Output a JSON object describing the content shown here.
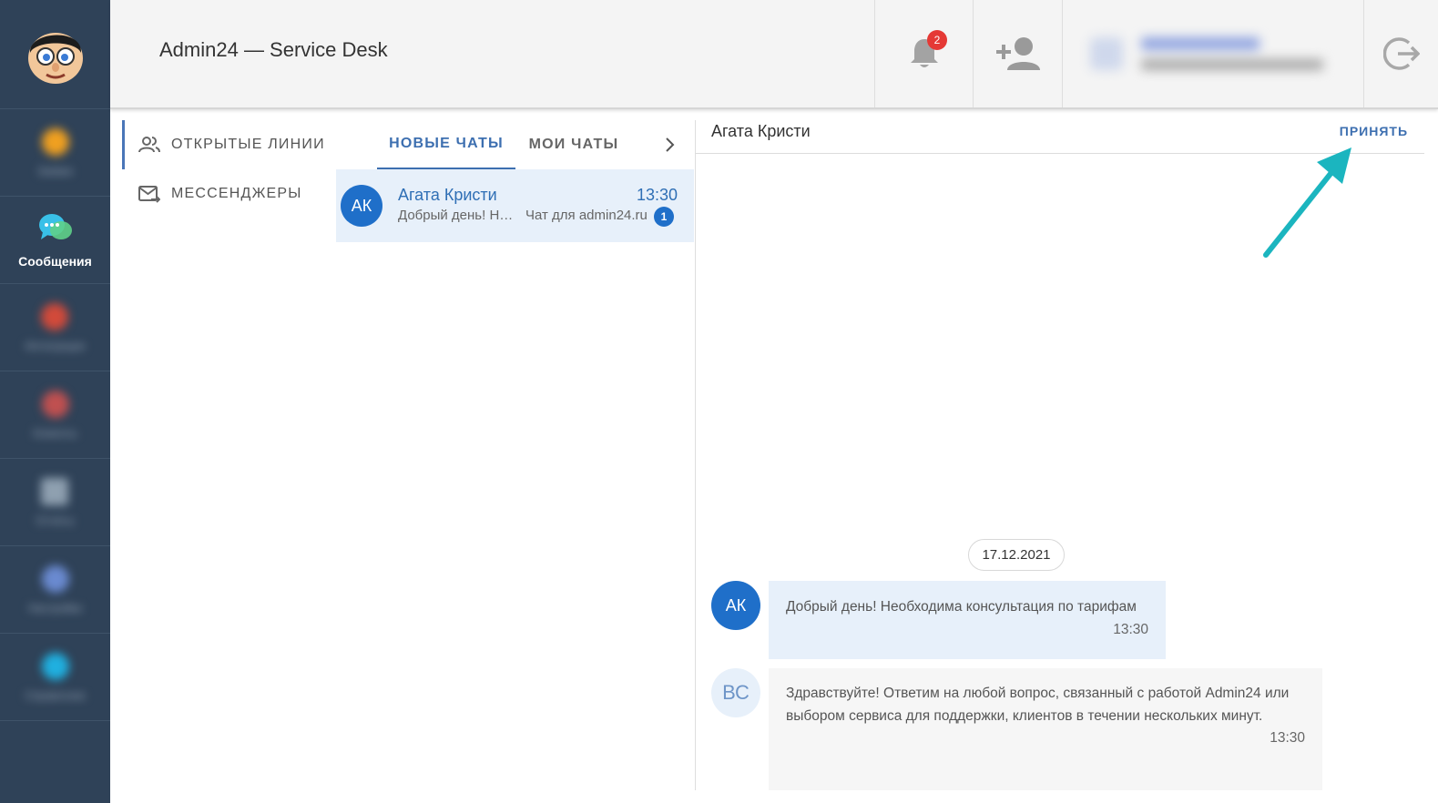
{
  "header": {
    "title": "Admin24 — Service Desk",
    "notifications_count": "2"
  },
  "sidebar": {
    "items": [
      {
        "label": "Заявки",
        "icon": "tickets-icon",
        "color": "#f0a020"
      },
      {
        "label": "Сообщения",
        "icon": "chat-bubbles-icon",
        "color": "#39c0e8"
      },
      {
        "label": "Интеграции",
        "icon": "integrations-icon",
        "color": "#d24a3a"
      },
      {
        "label": "Клиенты",
        "icon": "clients-icon",
        "color": "#c05050"
      },
      {
        "label": "Отчёты",
        "icon": "reports-icon",
        "color": "#8fa0b0"
      },
      {
        "label": "Настройки",
        "icon": "settings-icon",
        "color": "#6a8ad0"
      },
      {
        "label": "Справочник",
        "icon": "directory-icon",
        "color": "#20b0e0"
      }
    ]
  },
  "nav": {
    "open_lines": "ОТКРЫТЫЕ ЛИНИИ",
    "messengers": "МЕССЕНДЖЕРЫ"
  },
  "tabs": {
    "new_chats": "НОВЫЕ ЧАТЫ",
    "my_chats": "МОИ ЧАТЫ"
  },
  "chat_list": [
    {
      "initials": "АК",
      "name": "Агата Кристи",
      "time": "13:30",
      "preview": "Добрый день! Необходима консультация по тарифам",
      "line": "Чат для admin24.ru",
      "unread": "1"
    }
  ],
  "chat": {
    "contact_name": "Агата Кристи",
    "accept_label": "ПРИНЯТЬ",
    "date": "17.12.2021",
    "messages": [
      {
        "initials": "АК",
        "text": "Добрый день! Необходима консультация по тарифам",
        "time": "13:30"
      },
      {
        "initials": "ВС",
        "text": "Здравствуйте! Ответим на любой вопрос, связанный с работой Admin24 или выбором сервиса для поддержки, клиентов в течении нескольких минут.",
        "time": "13:30"
      }
    ]
  },
  "colors": {
    "sidebar_bg": "#2f4258",
    "accent": "#3d6fb0",
    "avatar": "#1f6fc9",
    "badge": "#e53935",
    "annotation_arrow": "#1bb5bf"
  }
}
